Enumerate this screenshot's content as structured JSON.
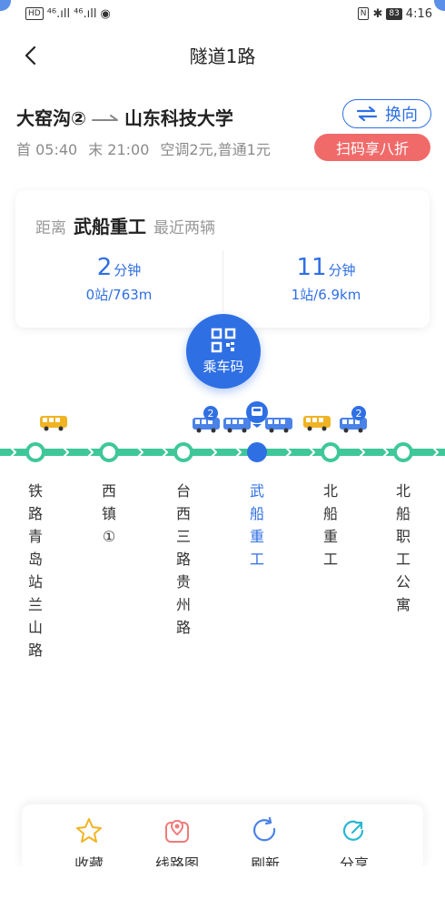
{
  "status_bar": {
    "left": [
      "HD",
      "⁴⁶.ıll",
      "⁴⁶.ıll",
      "◉"
    ],
    "right_icons": [
      "N",
      "✱"
    ],
    "battery": "83",
    "time": "4:16"
  },
  "nav": {
    "title": "隧道1路"
  },
  "route": {
    "from": "大窑沟②",
    "to": "山东科技大学",
    "reverse_label": "换向",
    "first_bus": "首 05:40",
    "last_bus": "末 21:00",
    "fare": "空调2元,普通1元",
    "promo": "扫码享八折"
  },
  "arrival": {
    "prefix": "距离",
    "stop": "武船重工",
    "suffix": "最近两辆",
    "buses": [
      {
        "minutes": "2",
        "unit": "分钟",
        "detail": "0站/763m"
      },
      {
        "minutes": "11",
        "unit": "分钟",
        "detail": "1站/6.9km"
      }
    ]
  },
  "qr": {
    "label": "乘车码"
  },
  "map": {
    "badges": [
      "2",
      "2"
    ],
    "stops": [
      {
        "name": "铁路青岛站兰山路",
        "current": false
      },
      {
        "name": "西镇①",
        "current": false
      },
      {
        "name": "台西三路贵州路",
        "current": false
      },
      {
        "name": "武船重工",
        "current": true
      },
      {
        "name": "北船重工",
        "current": false
      },
      {
        "name": "北船职工公寓",
        "current": false
      }
    ]
  },
  "actions": [
    {
      "label": "收藏",
      "icon": "star-icon"
    },
    {
      "label": "线路图",
      "icon": "map-pin-icon"
    },
    {
      "label": "刷新",
      "icon": "refresh-icon"
    },
    {
      "label": "分享",
      "icon": "share-icon"
    }
  ],
  "colors": {
    "accent": "#2f6fe4",
    "track": "#3fc79a",
    "promo": "#f06a6a",
    "muted": "#8a8a8a"
  }
}
